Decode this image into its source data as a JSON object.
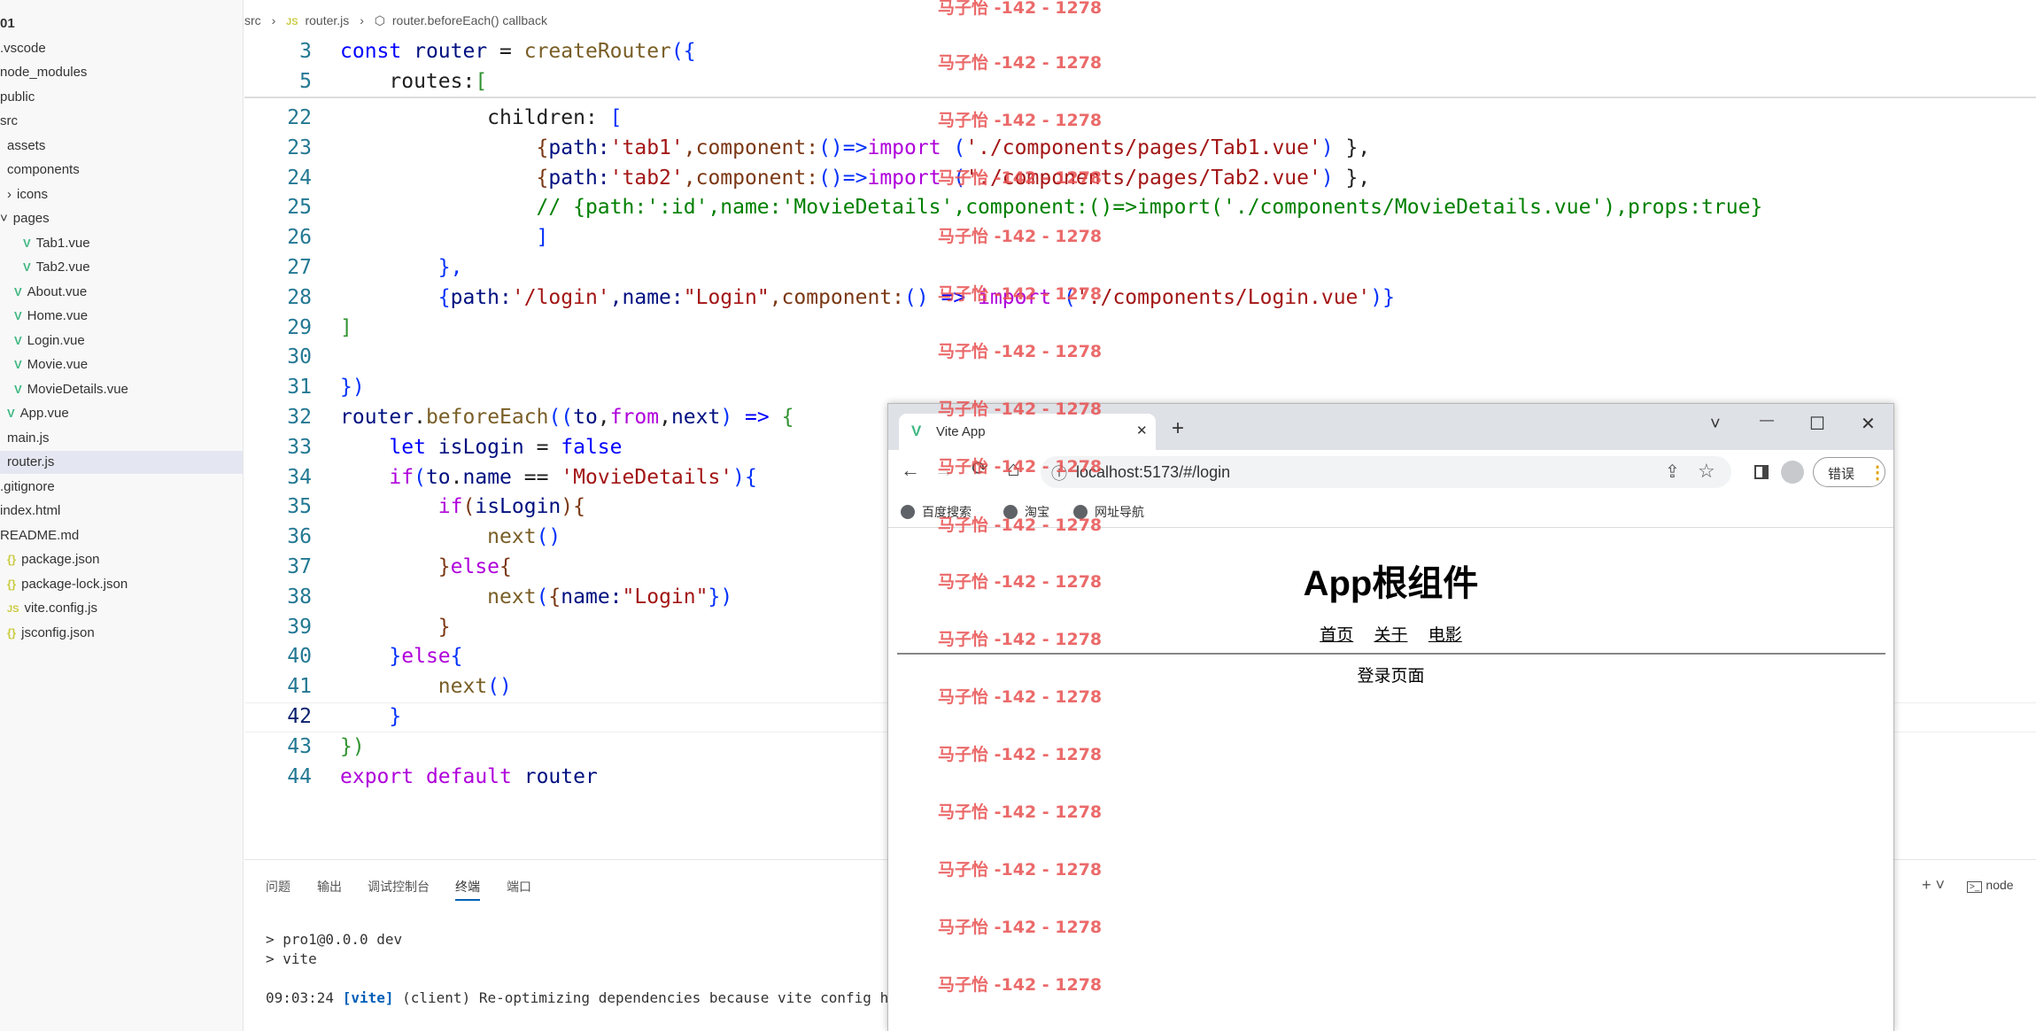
{
  "sidebar": {
    "items": [
      {
        "label": "01",
        "bold": true
      },
      {
        "label": ".vscode"
      },
      {
        "label": "node_modules"
      },
      {
        "label": "public"
      },
      {
        "label": "src"
      },
      {
        "label": "assets"
      },
      {
        "label": "components"
      },
      {
        "label": "icons",
        "chevron": "›"
      },
      {
        "label": "pages",
        "chevron": "˅"
      },
      {
        "label": "Tab1.vue",
        "icon": "V"
      },
      {
        "label": "Tab2.vue",
        "icon": "V"
      },
      {
        "label": "About.vue",
        "icon": "V"
      },
      {
        "label": "Home.vue",
        "icon": "V"
      },
      {
        "label": "Login.vue",
        "icon": "V"
      },
      {
        "label": "Movie.vue",
        "icon": "V"
      },
      {
        "label": "MovieDetails.vue",
        "icon": "V"
      },
      {
        "label": "App.vue",
        "icon": "V"
      },
      {
        "label": "main.js"
      },
      {
        "label": "router.js",
        "active": true
      },
      {
        "label": ".gitignore"
      },
      {
        "label": "index.html"
      },
      {
        "label": "README.md"
      },
      {
        "label": "package.json",
        "icon": "{}"
      },
      {
        "label": "package-lock.json",
        "icon": "{}"
      },
      {
        "label": "vite.config.js",
        "icon": "JS"
      },
      {
        "label": "jsconfig.json",
        "icon": "{}"
      }
    ]
  },
  "breadcrumb": {
    "src": "src",
    "file_icon": "JS",
    "file": "router.js",
    "symbol": "router.beforeEach() callback",
    "sep": "›"
  },
  "editor": {
    "sticky_lines": [
      {
        "n": "3",
        "tokens": [
          [
            "const ",
            "k"
          ],
          [
            "router",
            "v"
          ],
          [
            " = ",
            ""
          ],
          [
            "createRouter",
            "f"
          ],
          [
            "({",
            "b"
          ]
        ]
      },
      {
        "n": "5",
        "tokens": [
          [
            "    routes:",
            ""
          ],
          [
            "[",
            "b2"
          ]
        ]
      }
    ],
    "lines": [
      {
        "n": "22",
        "tokens": [
          [
            "            children: ",
            ""
          ],
          [
            "[",
            "b"
          ]
        ]
      },
      {
        "n": "23",
        "tokens": [
          [
            "                {",
            "b3"
          ],
          [
            "path:",
            "v"
          ],
          [
            "'tab1'",
            "s"
          ],
          [
            ",component:",
            "p"
          ],
          [
            "()=>",
            "b"
          ],
          [
            "import",
            "k2"
          ],
          [
            " (",
            "b"
          ],
          [
            "'./components/pages/Tab1.vue'",
            "s"
          ],
          [
            ")",
            "b"
          ],
          [
            " },",
            ""
          ]
        ]
      },
      {
        "n": "24",
        "tokens": [
          [
            "                {",
            "b3"
          ],
          [
            "path:",
            "v"
          ],
          [
            "'tab2'",
            "s"
          ],
          [
            ",component:",
            "p"
          ],
          [
            "()=>",
            "b"
          ],
          [
            "import",
            "k2"
          ],
          [
            " (",
            "b"
          ],
          [
            "'./components/pages/Tab2.vue'",
            "s"
          ],
          [
            ")",
            "b"
          ],
          [
            " },",
            ""
          ]
        ]
      },
      {
        "n": "25",
        "tokens": [
          [
            "                // {path:':id',name:'MovieDetails',component:()=>import('./components/MovieDetails.vue'),props:true}",
            "c"
          ]
        ]
      },
      {
        "n": "26",
        "tokens": [
          [
            "                ]",
            "b"
          ]
        ]
      },
      {
        "n": "27",
        "tokens": [
          [
            "        },",
            "b"
          ]
        ]
      },
      {
        "n": "28",
        "tokens": [
          [
            "        {",
            "b"
          ],
          [
            "path:",
            "v"
          ],
          [
            "'/login'",
            "s"
          ],
          [
            ",name:",
            "v"
          ],
          [
            "\"Login\"",
            "s"
          ],
          [
            ",component:",
            "p"
          ],
          [
            "() ",
            "b"
          ],
          [
            "=> ",
            "k"
          ],
          [
            "import ",
            "k2"
          ],
          [
            "(",
            "b"
          ],
          [
            "'./components/Login.vue'",
            "s"
          ],
          [
            ")}",
            "b"
          ]
        ]
      },
      {
        "n": "29",
        "tokens": [
          [
            "]",
            "b2"
          ]
        ]
      },
      {
        "n": "30",
        "tokens": [
          [
            "",
            ""
          ]
        ]
      },
      {
        "n": "31",
        "tokens": [
          [
            "})",
            "b"
          ]
        ]
      },
      {
        "n": "32",
        "tokens": [
          [
            "router",
            "v"
          ],
          [
            ".",
            ""
          ],
          [
            "beforeEach",
            "f"
          ],
          [
            "((",
            "b"
          ],
          [
            "to",
            "v"
          ],
          [
            ",",
            ""
          ],
          [
            "from",
            "k2"
          ],
          [
            ",",
            ""
          ],
          [
            "next",
            "v"
          ],
          [
            ") ",
            "b"
          ],
          [
            "=> ",
            "k"
          ],
          [
            "{",
            "b2"
          ]
        ]
      },
      {
        "n": "33",
        "tokens": [
          [
            "    ",
            ""
          ],
          [
            "let ",
            "k"
          ],
          [
            "isLogin",
            "v"
          ],
          [
            " = ",
            ""
          ],
          [
            "false",
            "k"
          ]
        ]
      },
      {
        "n": "34",
        "tokens": [
          [
            "    ",
            ""
          ],
          [
            "if",
            "k2"
          ],
          [
            "(",
            "b"
          ],
          [
            "to",
            "v"
          ],
          [
            ".",
            ""
          ],
          [
            "name",
            "v"
          ],
          [
            " == ",
            ""
          ],
          [
            "'MovieDetails'",
            "s"
          ],
          [
            "){",
            "b"
          ]
        ]
      },
      {
        "n": "35",
        "tokens": [
          [
            "        ",
            ""
          ],
          [
            "if",
            "k2"
          ],
          [
            "(",
            "b3"
          ],
          [
            "isLogin",
            "v"
          ],
          [
            "){",
            "b3"
          ]
        ]
      },
      {
        "n": "36",
        "tokens": [
          [
            "            ",
            ""
          ],
          [
            "next",
            "f"
          ],
          [
            "()",
            "b"
          ]
        ]
      },
      {
        "n": "37",
        "tokens": [
          [
            "        ",
            ""
          ],
          [
            "}",
            "b3"
          ],
          [
            "else",
            "k2"
          ],
          [
            "{",
            "b3"
          ]
        ]
      },
      {
        "n": "38",
        "tokens": [
          [
            "            ",
            ""
          ],
          [
            "next",
            "f"
          ],
          [
            "(",
            "b"
          ],
          [
            "{",
            "b3"
          ],
          [
            "name:",
            "v"
          ],
          [
            "\"Login\"",
            "s"
          ],
          [
            "})",
            "b"
          ]
        ]
      },
      {
        "n": "39",
        "tokens": [
          [
            "        }",
            "b3"
          ]
        ]
      },
      {
        "n": "40",
        "tokens": [
          [
            "    }",
            "b"
          ],
          [
            "else",
            "k2"
          ],
          [
            "{",
            "b"
          ]
        ]
      },
      {
        "n": "41",
        "tokens": [
          [
            "        ",
            ""
          ],
          [
            "next",
            "f"
          ],
          [
            "()",
            "b"
          ]
        ]
      },
      {
        "n": "42",
        "tokens": [
          [
            "    }",
            "b"
          ]
        ],
        "current": true
      },
      {
        "n": "43",
        "tokens": [
          [
            "})",
            "b2"
          ]
        ]
      },
      {
        "n": "44",
        "tokens": [
          [
            "export ",
            "k2"
          ],
          [
            "default ",
            "k2"
          ],
          [
            "router",
            "v"
          ]
        ]
      }
    ]
  },
  "panel": {
    "tabs": [
      "问题",
      "输出",
      "调试控制台",
      "终端",
      "端口"
    ],
    "active_tab": "终端",
    "terminal_lines": [
      "> pro1@0.0.0 dev",
      "> vite"
    ],
    "log_time": "09:03:24",
    "log_tag": "[vite]",
    "log_text": " (client) Re-optimizing dependencies because vite config has ch",
    "right_label": "node",
    "plus": "+ ˅"
  },
  "browser": {
    "tab_title": "Vite App",
    "tab_close": "✕",
    "new_tab": "+",
    "url": "localhost:5173/#/login",
    "error_button": "错误",
    "bookmarks": [
      "百度搜索",
      "淘宝",
      "网址导航"
    ],
    "page": {
      "heading": "App根组件",
      "nav_links": [
        "首页",
        "关于",
        "电影"
      ],
      "content": "登录页面"
    },
    "controls": {
      "minimize": "—",
      "maximize": "☐",
      "close": "✕",
      "dropdown": "˅"
    },
    "nav": {
      "back": "←",
      "forward": "→",
      "reload": "⟳",
      "home": "⌂",
      "star": "☆",
      "share": "⇪",
      "menu": "⋮",
      "info": "ⓘ"
    }
  },
  "watermark": {
    "text": "马子怡 -142 - 1278"
  },
  "colors": {
    "accent": "#005fb8",
    "watermark": "#e85050",
    "vue_green": "#41b883"
  }
}
